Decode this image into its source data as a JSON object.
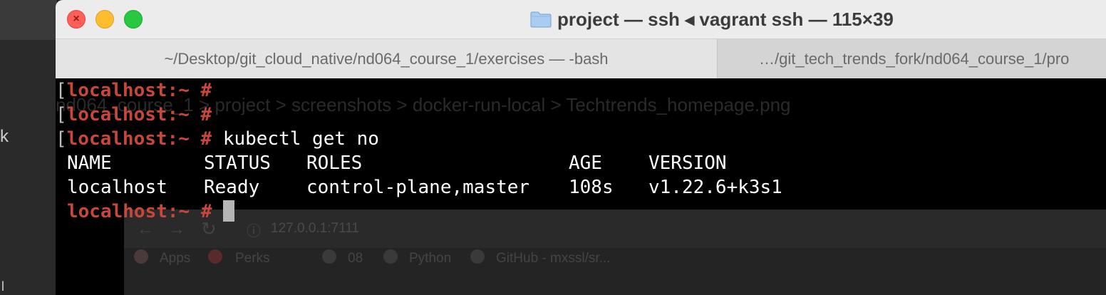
{
  "window": {
    "title": "project — ssh ◂ vagrant ssh — 115×39"
  },
  "tabs": [
    {
      "label": "~/Desktop/git_cloud_native/nd064_course_1/exercises — -bash"
    },
    {
      "label": "…/git_tech_trends_fork/nd064_course_1/pro"
    }
  ],
  "terminal": {
    "prompt": "localhost:~ #",
    "commands": [
      "",
      "",
      "kubectl get no"
    ],
    "table": {
      "headers": [
        "NAME",
        "STATUS",
        "ROLES",
        "AGE",
        "VERSION"
      ],
      "rows": [
        [
          "localhost",
          "Ready",
          "control-plane,master",
          "108s",
          "v1.22.6+k3s1"
        ]
      ]
    },
    "prompt_color": "#c8473b"
  },
  "background": {
    "breadcrumb": "nd064_course_1 > project > screenshots > docker-run-local >     Techtrends_homepage.png",
    "url": "127.0.0.1:7111",
    "bookmarks": [
      "Apps",
      "Perks",
      "08",
      "Python",
      "GitHub - mxssl/sr..."
    ]
  },
  "colors": {
    "close": "#fe5f57",
    "minimize": "#febc2e",
    "zoom": "#28c840"
  }
}
